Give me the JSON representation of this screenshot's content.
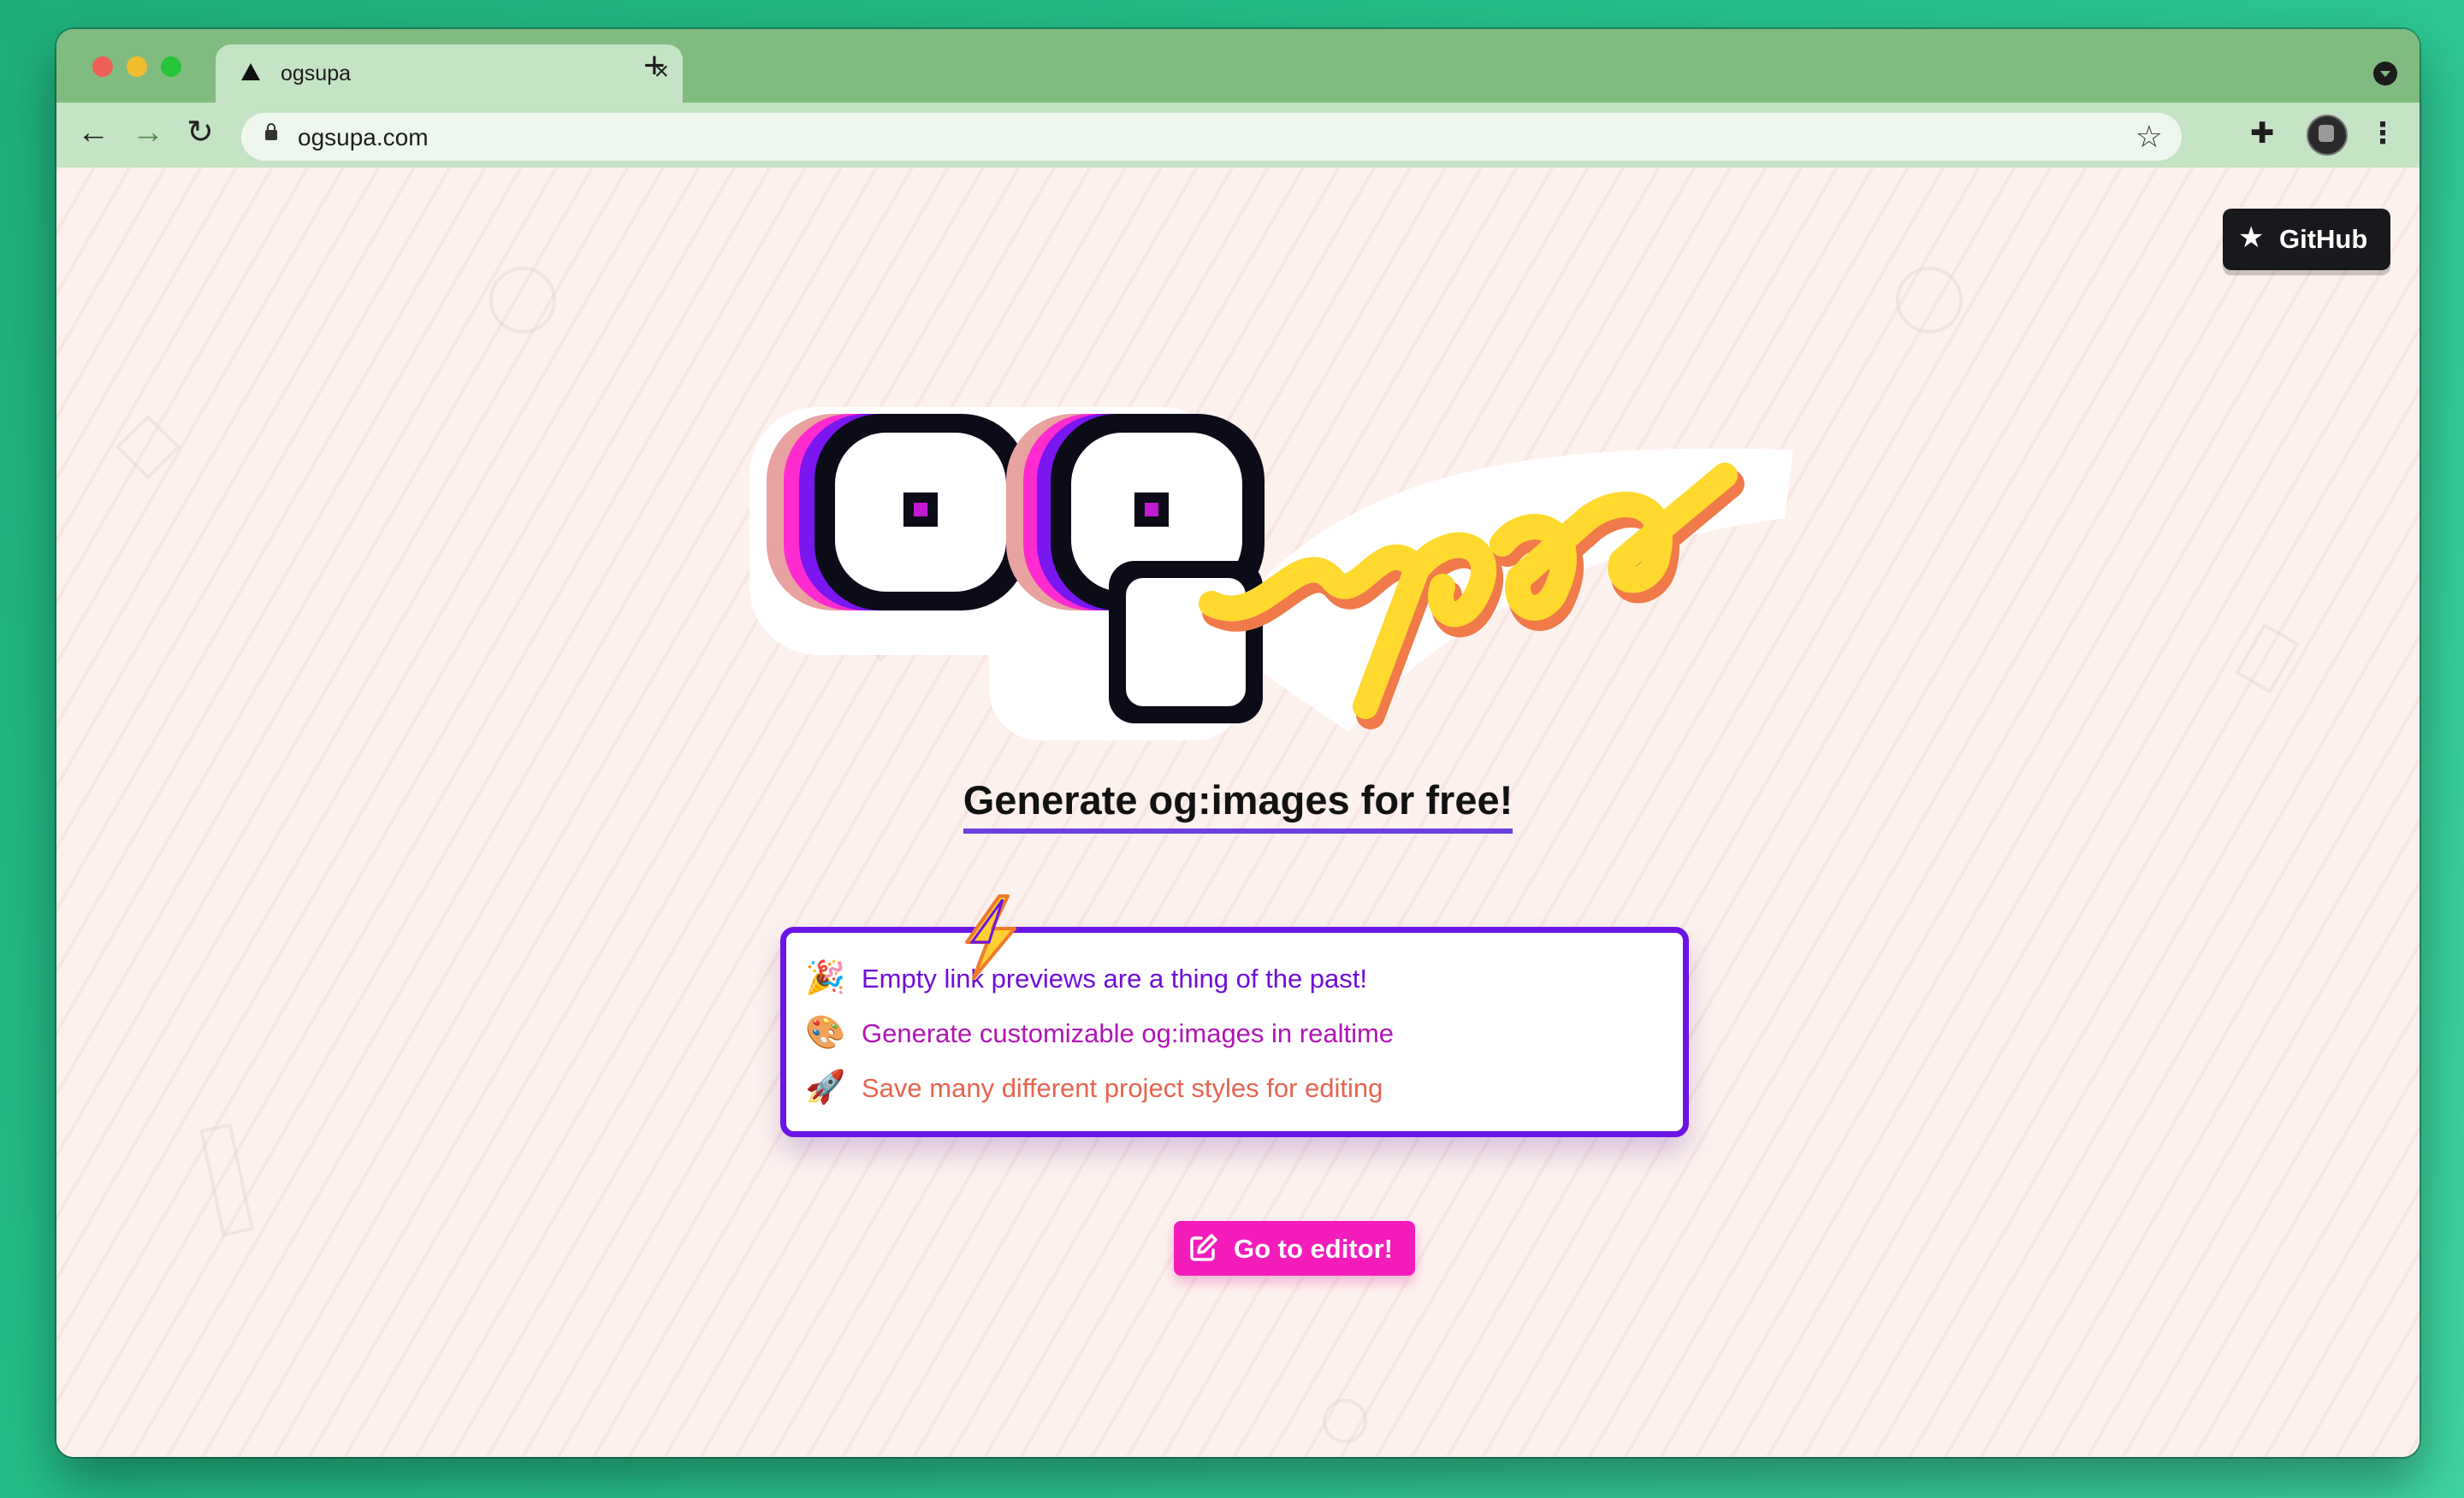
{
  "browser": {
    "tab_title": "ogsupa",
    "tab_close": "×",
    "new_tab": "+",
    "url": "ogsupa.com",
    "back": "←",
    "forward": "→",
    "reload": "↻",
    "bookmark": "☆",
    "extensions": "✚",
    "menu": "⋮"
  },
  "page": {
    "github_label": "GitHub",
    "github_icon": "★",
    "logo_text_og": "og",
    "logo_text_supa": "supa",
    "heading": "Generate og:images for free!",
    "features": [
      {
        "emoji": "🎉",
        "text": "Empty link previews are a thing of the past!"
      },
      {
        "emoji": "🎨",
        "text": "Generate customizable og:images in realtime"
      },
      {
        "emoji": "🚀",
        "text": "Save many different project styles for editing"
      }
    ],
    "cta_label": "Go to editor!"
  },
  "colors": {
    "tab_strip": "#80bc7f",
    "toolbar": "#c5e3c5",
    "page_bg": "#fdf1ee",
    "feature_border": "#6b14e6",
    "feature_1": "#6f0ed9",
    "feature_2": "#b015b6",
    "feature_3": "#e5644f",
    "cta_bg": "#f41dbb",
    "heading_underline": "#6d3fe0",
    "logo_yellow": "#ffd92e"
  }
}
